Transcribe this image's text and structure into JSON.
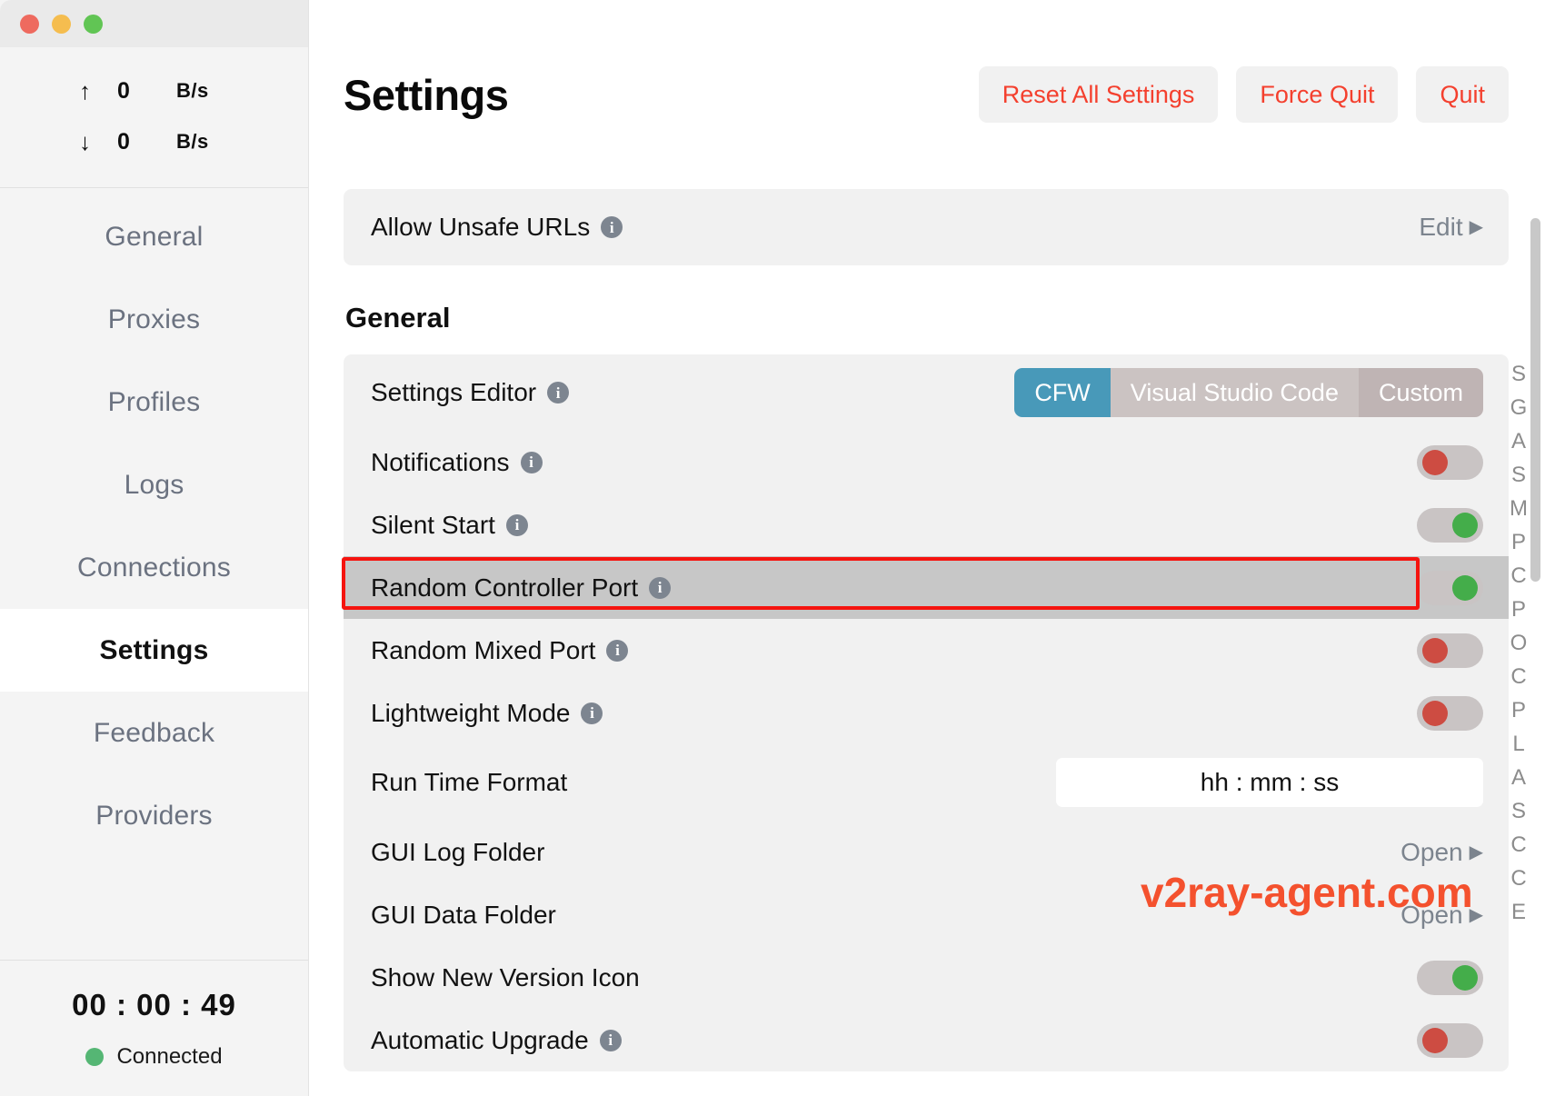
{
  "window": {
    "traffic_lights": [
      "close-red",
      "minimize-yellow",
      "maximize-green"
    ]
  },
  "sidebar": {
    "speed": {
      "upload": {
        "arrow": "↑",
        "value": "0",
        "unit": "B/s"
      },
      "download": {
        "arrow": "↓",
        "value": "0",
        "unit": "B/s"
      }
    },
    "items": [
      {
        "label": "General",
        "active": false
      },
      {
        "label": "Proxies",
        "active": false
      },
      {
        "label": "Profiles",
        "active": false
      },
      {
        "label": "Logs",
        "active": false
      },
      {
        "label": "Connections",
        "active": false
      },
      {
        "label": "Settings",
        "active": true
      },
      {
        "label": "Feedback",
        "active": false
      },
      {
        "label": "Providers",
        "active": false
      }
    ],
    "status": {
      "timer": "00 : 00 : 49",
      "connection_label": "Connected",
      "connection_color": "#55b674"
    }
  },
  "header": {
    "title": "Settings",
    "buttons": [
      {
        "label": "Reset All Settings"
      },
      {
        "label": "Force Quit"
      },
      {
        "label": "Quit"
      }
    ],
    "button_color": "#f4402e"
  },
  "content": {
    "top_card": {
      "rows": [
        {
          "label": "Allow Unsafe URLs",
          "info": true,
          "action": "Edit",
          "caret": "▶"
        }
      ]
    },
    "general_section": {
      "title": "General",
      "rows": [
        {
          "label": "Settings Editor",
          "info": true,
          "control": "segmented",
          "options": [
            "CFW",
            "Visual Studio Code",
            "Custom"
          ],
          "selected": "CFW"
        },
        {
          "label": "Notifications",
          "info": true,
          "control": "toggle",
          "value": "off"
        },
        {
          "label": "Silent Start",
          "info": true,
          "control": "toggle",
          "value": "on"
        },
        {
          "label": "Random Controller Port",
          "info": true,
          "control": "toggle",
          "value": "on",
          "highlighted": true
        },
        {
          "label": "Random Mixed Port",
          "info": true,
          "control": "toggle",
          "value": "off"
        },
        {
          "label": "Lightweight Mode",
          "info": true,
          "control": "toggle",
          "value": "off"
        },
        {
          "label": "Run Time Format",
          "info": false,
          "control": "textfield",
          "value": "hh : mm : ss"
        },
        {
          "label": "GUI Log Folder",
          "info": false,
          "control": "link",
          "action": "Open",
          "caret": "▶"
        },
        {
          "label": "GUI Data Folder",
          "info": false,
          "control": "link",
          "action": "Open",
          "caret": "▶"
        },
        {
          "label": "Show New Version Icon",
          "info": false,
          "control": "toggle",
          "value": "on"
        },
        {
          "label": "Automatic Upgrade",
          "info": true,
          "control": "toggle",
          "value": "off"
        }
      ]
    },
    "index_rail": [
      "S",
      "G",
      "A",
      "S",
      "M",
      "P",
      "C",
      "P",
      "O",
      "C",
      "P",
      "L",
      "A",
      "S",
      "C",
      "C",
      "E"
    ],
    "watermark": "v2ray-agent.com",
    "accent_active": "#4899b9",
    "toggle_on_color": "#44ad4a",
    "toggle_off_color": "#cd4c42",
    "highlight_border_color": "#f5140f"
  }
}
